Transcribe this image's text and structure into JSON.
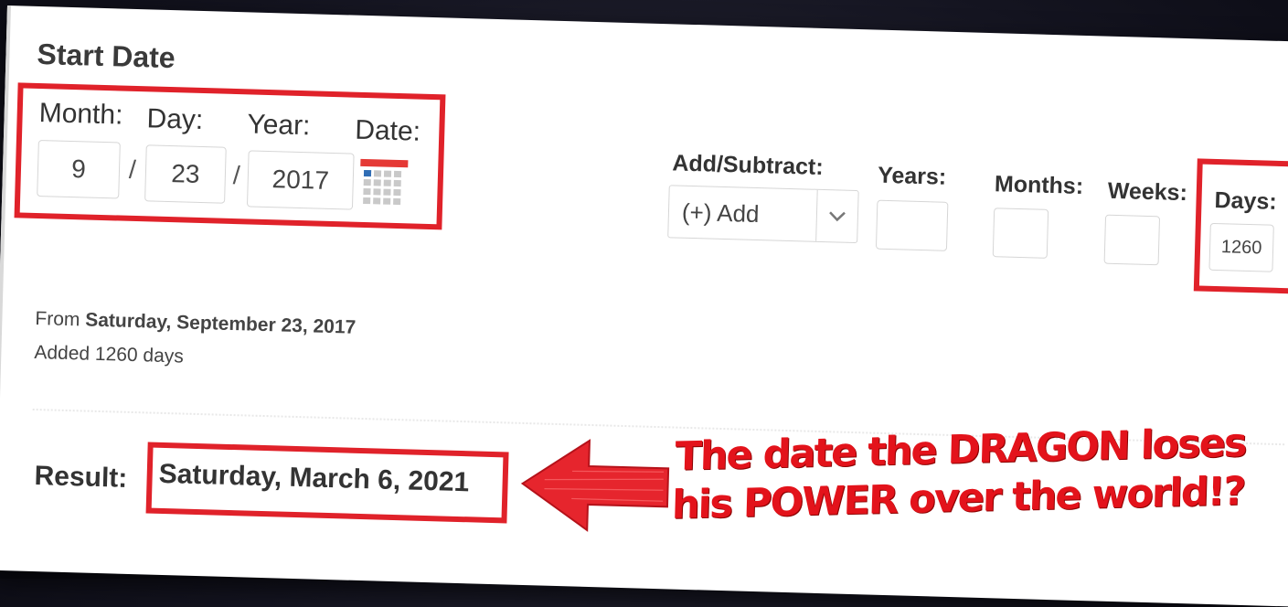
{
  "start_date": {
    "title": "Start Date",
    "month_label": "Month:",
    "day_label": "Day:",
    "year_label": "Year:",
    "date_label": "Date:",
    "month_value": "9",
    "day_value": "23",
    "year_value": "2017",
    "separator": "/",
    "calendar_icon": "calendar-icon"
  },
  "add_subtract": {
    "label": "Add/Subtract:",
    "selected": "(+) Add",
    "years_label": "Years:",
    "months_label": "Months:",
    "weeks_label": "Weeks:",
    "days_label": "Days:",
    "years_value": "",
    "months_value": "",
    "weeks_value": "",
    "days_value": "1260"
  },
  "summary": {
    "from_prefix": "From",
    "from_date": "Saturday, September 23, 2017",
    "added": "Added 1260 days"
  },
  "result": {
    "label": "Result:",
    "value": "Saturday, March 6, 2021"
  },
  "annotation": {
    "line1": "The date the DRAGON loses",
    "line2": "his POWER over the world!?"
  },
  "colors": {
    "highlight": "#e0222a",
    "annotation": "#e3131b",
    "calendar_accent": "#e53935"
  }
}
